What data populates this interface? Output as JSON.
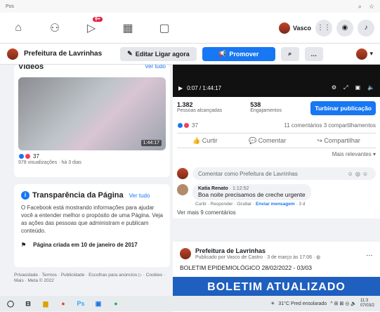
{
  "browser": {
    "tab_text": "Pos",
    "icons": [
      "zoom-icon",
      "star-icon"
    ]
  },
  "topnav": {
    "icons": [
      "home-icon",
      "friends-icon",
      "video-icon",
      "marketplace-icon",
      "groups-icon"
    ],
    "video_badge": "9+",
    "user_name": "Vasco"
  },
  "pagebar": {
    "page_name": "Prefeitura de Lavrinhas",
    "edit_label": "Editar Ligar agora",
    "promote_label": "Promover"
  },
  "videos": {
    "title": "Vídeos",
    "see_all": "Ver tudo",
    "duration": "1:44:17",
    "reactions": "37",
    "views": "978 visualizações · há 3 dias"
  },
  "transparency": {
    "title": "Transparência da Página",
    "see_all": "Ver tudo",
    "body": "O Facebook está mostrando informações para ajudar você a entender melhor o propósito de uma Página. Veja as ações das pessoas que administram e publicam conteúdo.",
    "created": "Página criada em 10 de janeiro de 2017"
  },
  "footer": "Privacidade · Termos · Publicidade · Escolhas para anúncios ▷ · Cookies · Mais · Meta © 2022",
  "post": {
    "time": "0:07 / 1:44:17",
    "reach_num": "1.382",
    "reach_lbl": "Pessoas alcançadas",
    "eng_num": "538",
    "eng_lbl": "Engajamentos",
    "boost": "Turbinar publicação",
    "reactions": "37",
    "comments_shares": "11 comentários 3 compartilhamentos",
    "like": "Curtir",
    "comment": "Comentar",
    "share": "Compartilhar",
    "relevance": "Mais relevantes ▾",
    "comment_placeholder": "Comentar como Prefeitura de Lavrinhas",
    "commenter": "Katia Renato",
    "comment_time": "· 1:12:52",
    "comment_text": "Boa noite precisamos de creche urgente",
    "comment_actions": [
      "Curtir",
      "Responder",
      "Ocultar",
      "Enviar mensagem",
      "3 d"
    ],
    "more_comments": "Ver mais 9 comentários"
  },
  "post2": {
    "name": "Prefeitura de Lavrinhas",
    "meta": "Publicado por Vasco de Castro · 3 de março às 17:06 · ",
    "text": "BOLETIM EPIDEMIOLÓGICO 28/02/2022 - 03/03",
    "banner": "BOLETIM ATUALIZADO"
  },
  "taskbar": {
    "weather": "31°C Pred ensolarado",
    "clock": "11:3\n07/03/2"
  }
}
